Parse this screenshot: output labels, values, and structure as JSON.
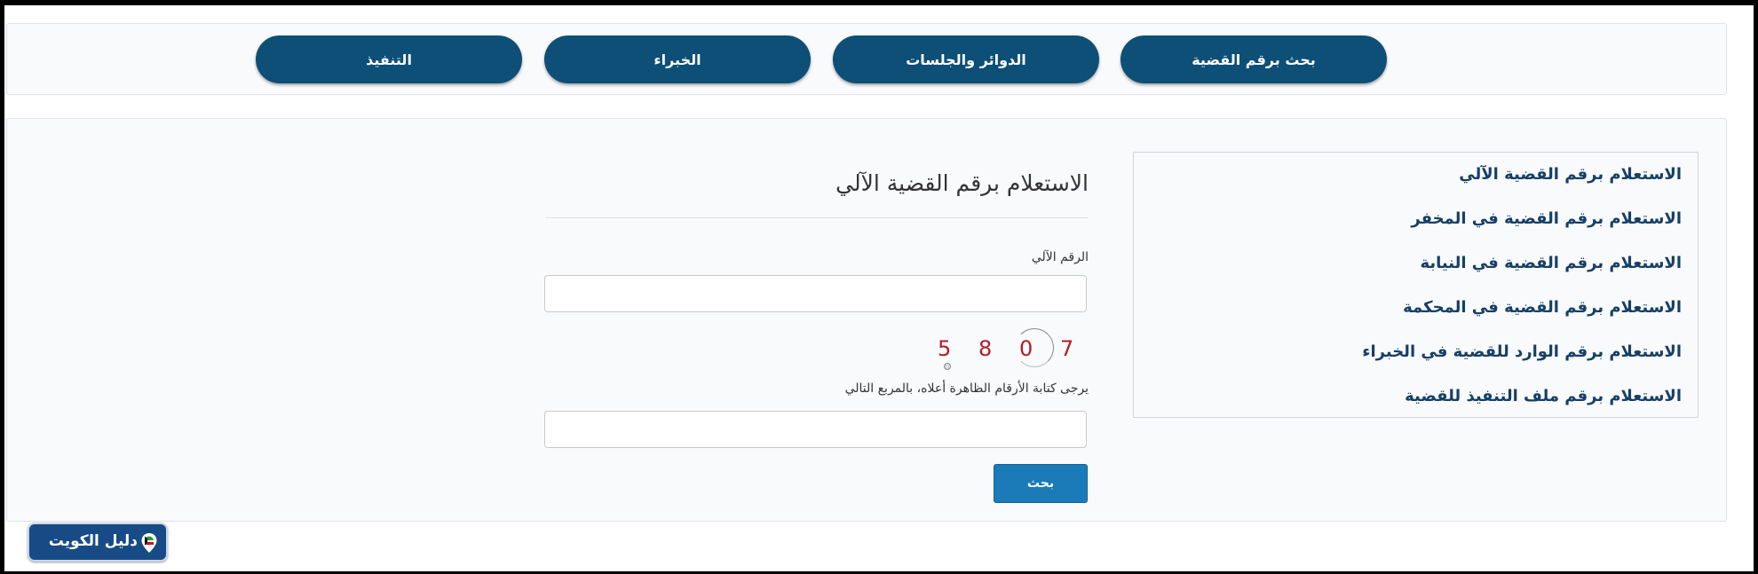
{
  "nav": {
    "tabs": [
      {
        "label": "بحث برقم القضية"
      },
      {
        "label": "الدوائر والجلسات"
      },
      {
        "label": "الخبراء"
      },
      {
        "label": "التنفيذ"
      }
    ]
  },
  "sidebar": {
    "items": [
      {
        "label": "الاستعلام برقم القضية الآلي"
      },
      {
        "label": "الاستعلام برقم القضية في المخفر"
      },
      {
        "label": "الاستعلام برقم القضية في النيابة"
      },
      {
        "label": "الاستعلام برقم القضية في المحكمة"
      },
      {
        "label": "الاستعلام برقم الوارد للقضية في الخبراء"
      },
      {
        "label": "الاستعلام برقم ملف التنفيذ للقضية"
      }
    ]
  },
  "form": {
    "title": "الاستعلام برقم القضية الآلي",
    "case_number_label": "الرقم الآلي",
    "case_number_value": "",
    "captcha_digits": [
      "5",
      "8",
      "0",
      "7"
    ],
    "captcha_hint": "يرجى كتابة الأرقام الظاهرة أعلاه، بالمربع التالي",
    "captcha_value": "",
    "search_label": "بحث"
  },
  "badge": {
    "text": "دليل الكويت"
  },
  "colors": {
    "nav_button": "#0d4f76",
    "sidebar_link": "#163f66",
    "search_button": "#1b7bb9",
    "captcha_digits": "#b21e24",
    "badge": "#184a86"
  },
  "icons": [
    "location-pin-icon"
  ]
}
